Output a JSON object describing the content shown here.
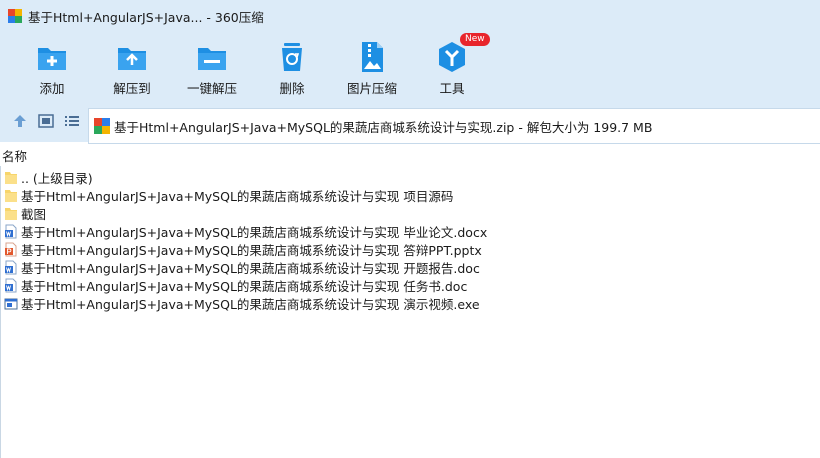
{
  "window": {
    "title": "基于Html+AngularJS+Java... - 360压缩"
  },
  "toolbar": {
    "add": "添加",
    "extract_to": "解压到",
    "one_click_extract": "一键解压",
    "delete": "删除",
    "image_compress": "图片压缩",
    "tools": "工具",
    "tools_badge": "New"
  },
  "address": {
    "path": "基于Html+AngularJS+Java+MySQL的果蔬店商城系统设计与实现.zip - 解包大小为 199.7 MB"
  },
  "list": {
    "column_name": "名称",
    "items": [
      {
        "name": ".. (上级目录)",
        "icon": "folder-icon"
      },
      {
        "name": "基于Html+AngularJS+Java+MySQL的果蔬店商城系统设计与实现 项目源码",
        "icon": "folder-icon"
      },
      {
        "name": "截图",
        "icon": "folder-icon"
      },
      {
        "name": "基于Html+AngularJS+Java+MySQL的果蔬店商城系统设计与实现 毕业论文.docx",
        "icon": "word-doc-icon"
      },
      {
        "name": "基于Html+AngularJS+Java+MySQL的果蔬店商城系统设计与实现 答辩PPT.pptx",
        "icon": "ppt-icon"
      },
      {
        "name": "基于Html+AngularJS+Java+MySQL的果蔬店商城系统设计与实现 开题报告.doc",
        "icon": "word-doc-icon"
      },
      {
        "name": "基于Html+AngularJS+Java+MySQL的果蔬店商城系统设计与实现 任务书.doc",
        "icon": "word-doc-icon"
      },
      {
        "name": "基于Html+AngularJS+Java+MySQL的果蔬店商城系统设计与实现 演示视频.exe",
        "icon": "exe-icon"
      }
    ]
  },
  "colors": {
    "header_bg": "#dcebf8",
    "accent_blue": "#1e8fe3",
    "folder_yellow": "#f7d56b",
    "word_blue": "#2f6fd1",
    "ppt_orange": "#e2582c",
    "badge_red": "#e8252c"
  }
}
